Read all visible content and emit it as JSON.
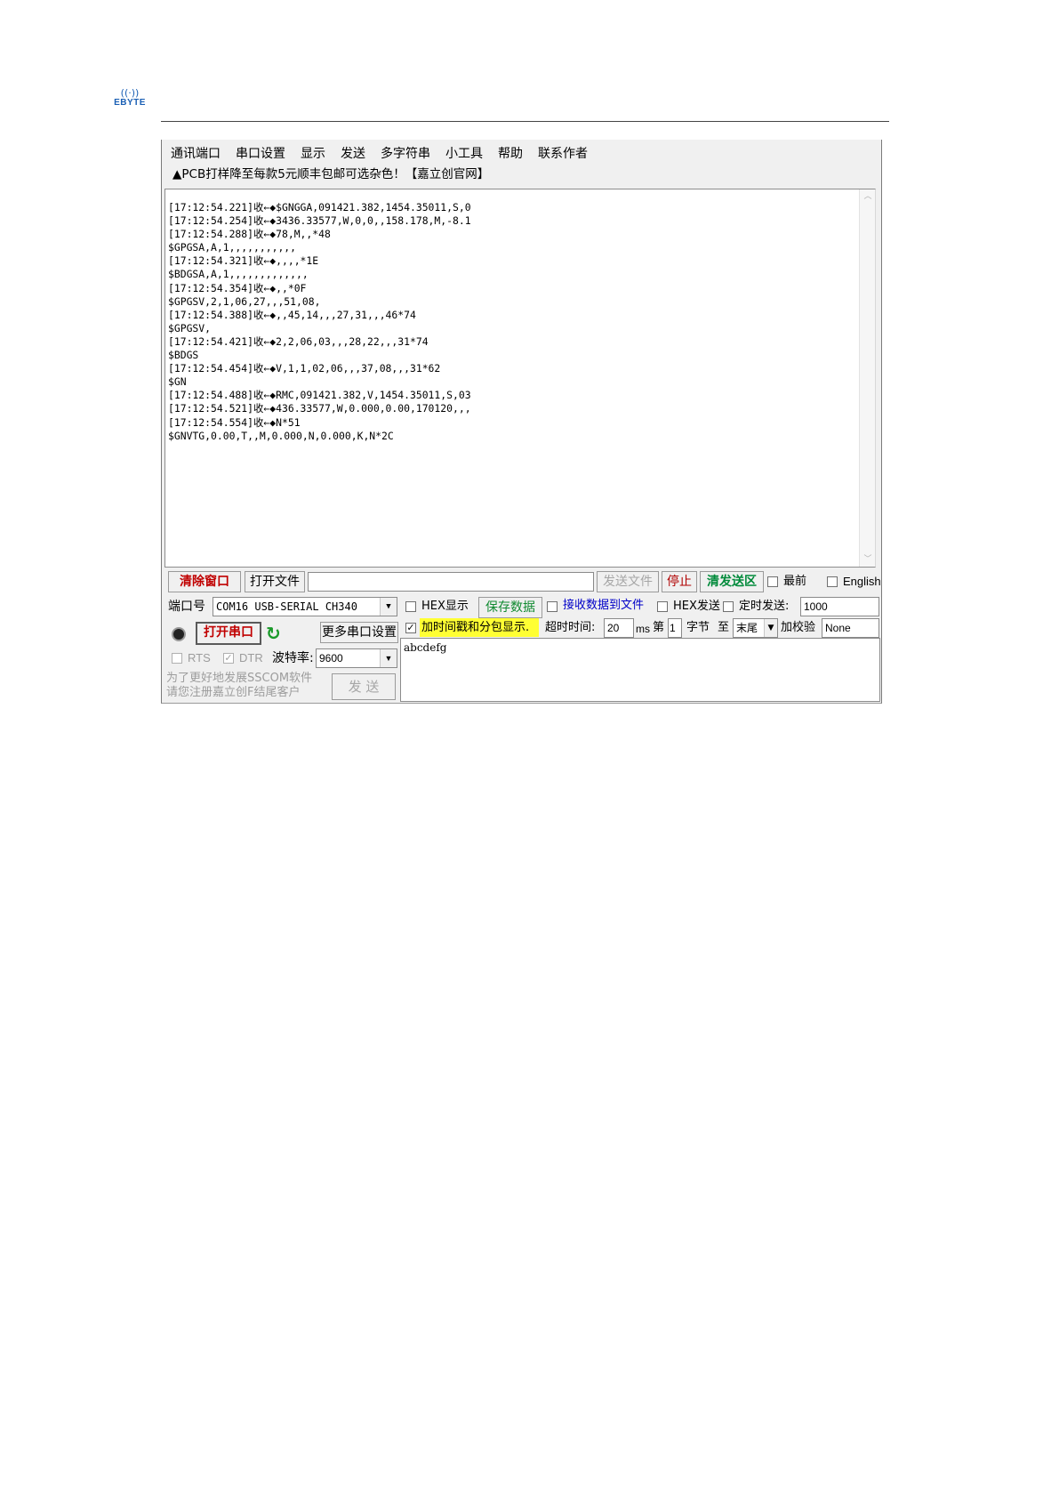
{
  "header": {
    "logo_text": "EBYTE"
  },
  "menu": [
    "通讯端口",
    "串口设置",
    "显示",
    "发送",
    "多字符串",
    "小工具",
    "帮助",
    "联系作者"
  ],
  "ad_text": "▲PCB打样降至每款5元顺丰包邮可选杂色！【嘉立创官网】",
  "receive_lines": [
    "[17:12:54.221]收←◆$GNGGA,091421.382,1454.35011,S,0",
    "[17:12:54.254]收←◆3436.33577,W,0,0,,158.178,M,-8.1",
    "[17:12:54.288]收←◆78,M,,*48",
    "$GPGSA,A,1,,,,,,,,,,,",
    "[17:12:54.321]收←◆,,,,*1E",
    "$BDGSA,A,1,,,,,,,,,,,,,",
    "[17:12:54.354]收←◆,,*0F",
    "$GPGSV,2,1,06,27,,,51,08,",
    "[17:12:54.388]收←◆,,45,14,,,27,31,,,46*74",
    "$GPGSV,",
    "[17:12:54.421]收←◆2,2,06,03,,,28,22,,,31*74",
    "$BDGS",
    "[17:12:54.454]收←◆V,1,1,02,06,,,37,08,,,31*62",
    "$GN",
    "[17:12:54.488]收←◆RMC,091421.382,V,1454.35011,S,03",
    "[17:12:54.521]收←◆436.33577,W,0.000,0.00,170120,,,",
    "[17:12:54.554]收←◆N*51",
    "$GNVTG,0.00,T,,M,0.000,N,0.000,K,N*2C"
  ],
  "toolbar": {
    "clear_window": "清除窗口",
    "open_file": "打开文件",
    "file_path": "",
    "send_file": "发送文件",
    "stop": "停止",
    "clear_send": "清发送区",
    "topmost": "最前",
    "english": "English"
  },
  "port": {
    "port_label": "端口号",
    "port_value": "COM16 USB-SERIAL CH340",
    "open_port": "打开串口",
    "more_settings": "更多串口设置",
    "rts": "RTS",
    "dtr": "DTR",
    "baud_label": "波特率:",
    "baud_value": "9600",
    "promo_line1": "为了更好地发展SSCOM软件",
    "promo_line2": "请您注册嘉立创F结尾客户",
    "send": "发 送"
  },
  "options": {
    "hex_display": "HEX显示",
    "save_data": "保存数据",
    "recv_to_file": "接收数据到文件",
    "hex_send": "HEX发送",
    "timed_send": "定时发送:",
    "timed_value": "1000",
    "timestamp": "加时间戳和分包显示.",
    "timeout_label": "超时时间:",
    "timeout_value": "20",
    "ms": "ms",
    "nth": "第",
    "byte_index": "1",
    "byte_label": "字节",
    "to": "至",
    "end_value": "末尾",
    "checksum": "加校验",
    "checksum_value": "None"
  },
  "send_text": "abcdefg"
}
